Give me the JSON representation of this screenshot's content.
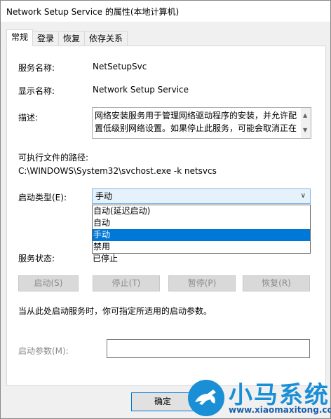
{
  "window": {
    "title": "Network Setup Service 的属性(本地计算机)"
  },
  "tabs": [
    {
      "label": "常规",
      "active": true
    },
    {
      "label": "登录",
      "active": false
    },
    {
      "label": "恢复",
      "active": false
    },
    {
      "label": "依存关系",
      "active": false
    }
  ],
  "general": {
    "service_name_label": "服务名称:",
    "service_name_value": "NetSetupSvc",
    "display_name_label": "显示名称:",
    "display_name_value": "Network Setup Service",
    "description_label": "描述:",
    "description_value": "网络安装服务用于管理网络驱动程序的安装，并允许配置低级别网络设置。如果停止此服务，可能会取消正在",
    "exe_path_label": "可执行文件的路径:",
    "exe_path_value": "C:\\WINDOWS\\System32\\svchost.exe -k netsvcs",
    "startup_type_label": "启动类型(E):",
    "startup_type_selected": "手动",
    "startup_type_options": [
      "自动(延迟启动)",
      "自动",
      "手动",
      "禁用"
    ],
    "service_status_label": "服务状态:",
    "service_status_value": "已停止",
    "buttons": {
      "start": "启动(S)",
      "stop": "停止(T)",
      "pause": "暂停(P)",
      "resume": "恢复(R)"
    },
    "hint_text": "当从此处启动服务时，你可指定所适用的启动参数。",
    "start_params_label": "启动参数(M):",
    "start_params_value": ""
  },
  "footer": {
    "ok_label": "确定"
  },
  "watermark": {
    "text": "小马系统",
    "url": "www.xiaomaxitong.com"
  },
  "colors": {
    "accent": "#0078d7",
    "select_bg": "#e5f1fb"
  }
}
